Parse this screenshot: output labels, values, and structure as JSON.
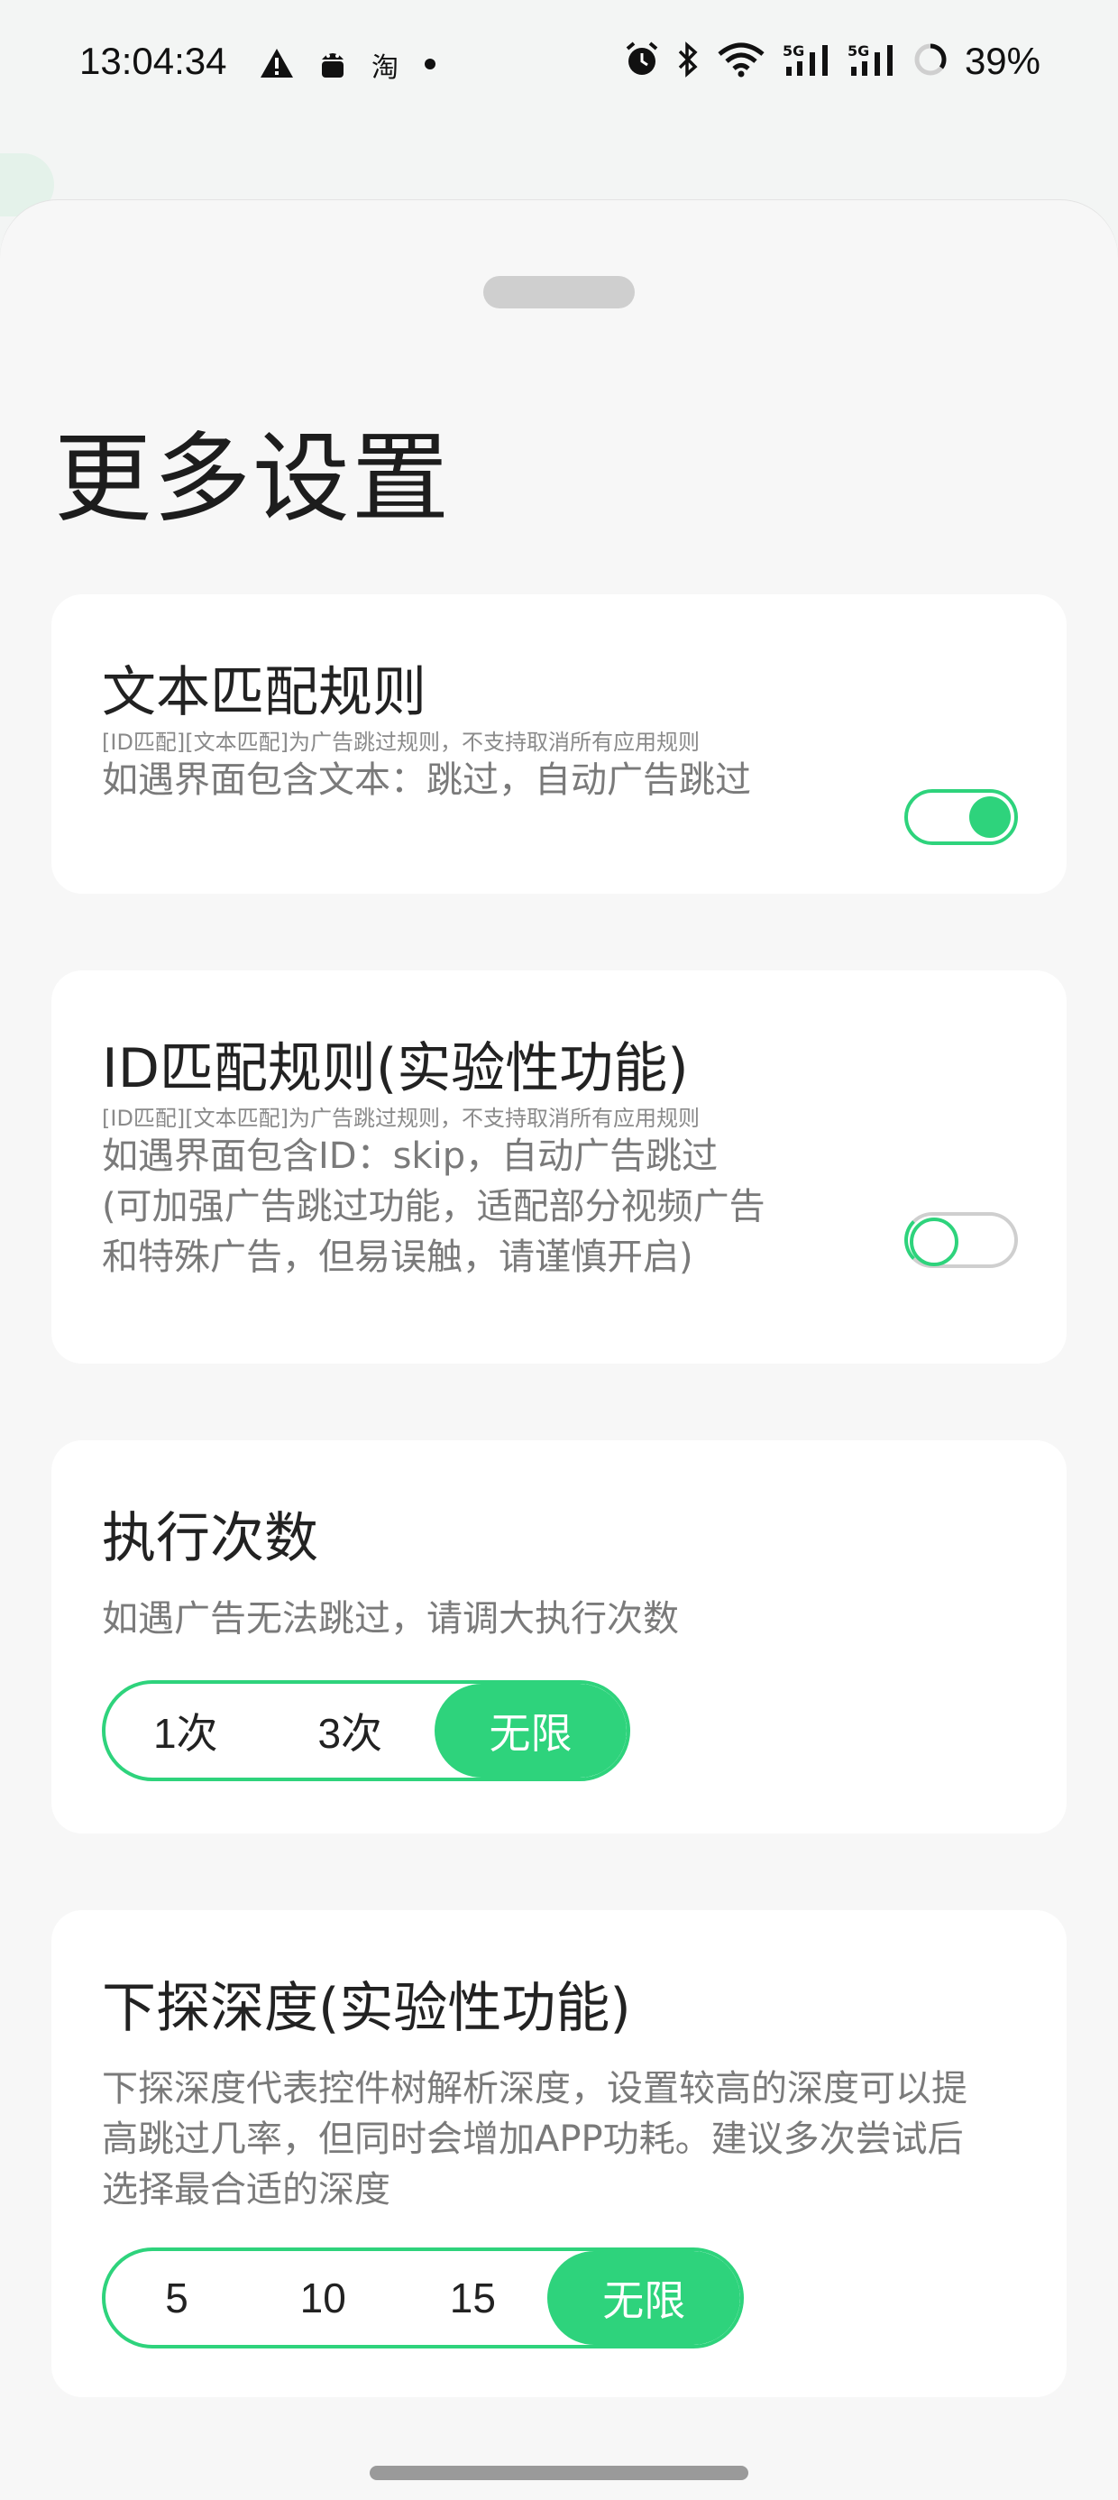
{
  "status_bar": {
    "time": "13:04:34",
    "left_icons": [
      "warning-icon",
      "android-icon",
      "taobao-icon",
      "dot-icon"
    ],
    "taobao_label": "淘",
    "right_icons": [
      "alarm-icon",
      "bluetooth-icon",
      "wifi-icon",
      "signal-5g-icon",
      "signal-5g-icon",
      "battery-ring-icon"
    ],
    "battery": "39%"
  },
  "sheet": {
    "title": "更多设置"
  },
  "text_rule": {
    "title": "文本匹配规则",
    "note": "[ID匹配][文本匹配]为广告跳过规则，不支持取消所有应用规则",
    "desc": "如遇界面包含文本：跳过，自动广告跳过",
    "enabled": true
  },
  "id_rule": {
    "title": "ID匹配规则(实验性功能)",
    "note": "[ID匹配][文本匹配]为广告跳过规则，不支持取消所有应用规则",
    "desc_line1": "如遇界面包含ID：skip，自动广告跳过",
    "desc_line2": "(可加强广告跳过功能，适配部分视频广告",
    "desc_line3": "和特殊广告，但易误触，请谨慎开启)",
    "enabled": false
  },
  "exec_count": {
    "title": "执行次数",
    "desc": "如遇广告无法跳过，请调大执行次数",
    "options": [
      "1次",
      "3次",
      "无限"
    ],
    "selected_index": 2
  },
  "depth": {
    "title": "下探深度(实验性功能)",
    "desc_line1": "下探深度代表控件树解析深度，设置较高的深度可以提",
    "desc_line2": "高跳过几率，但同时会增加APP功耗。建议多次尝试后",
    "desc_line3": "选择最合适的深度",
    "options": [
      "5",
      "10",
      "15",
      "无限"
    ],
    "selected_index": 3
  },
  "colors": {
    "accent": "#2ed37c",
    "card": "#ffffff",
    "sheet": "#f7f7f7"
  }
}
